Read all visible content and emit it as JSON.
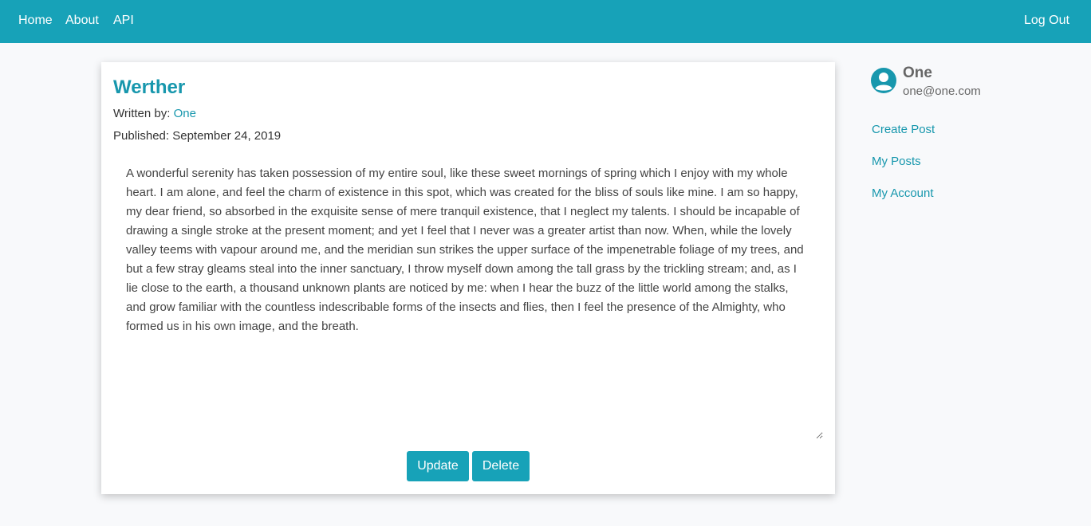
{
  "nav": {
    "home": "Home",
    "about": "About",
    "api": "API",
    "logout": "Log Out"
  },
  "post": {
    "title": "Werther",
    "written_by_label": "Written by:",
    "author": "One",
    "published": "Published: September 24, 2019",
    "content": "A wonderful serenity has taken possession of my entire soul, like these sweet mornings of spring which I enjoy with my whole heart. I am alone, and feel the charm of existence in this spot, which was created for the bliss of souls like mine. I am so happy, my dear friend, so absorbed in the exquisite sense of mere tranquil existence, that I neglect my talents. I should be incapable of drawing a single stroke at the present moment; and yet I feel that I never was a greater artist than now. When, while the lovely valley teems with vapour around me, and the meridian sun strikes the upper surface of the impenetrable foliage of my trees, and but a few stray gleams steal into the inner sanctuary, I throw myself down among the tall grass by the trickling stream; and, as I lie close to the earth, a thousand unknown plants are noticed by me: when I hear the buzz of the little world among the stalks, and grow familiar with the countless indescribable forms of the insects and flies, then I feel the presence of the Almighty, who formed us in his own image, and the breath.",
    "update_label": "Update",
    "delete_label": "Delete"
  },
  "sidebar": {
    "name": "One",
    "email": "one@one.com",
    "links": [
      "Create Post",
      "My Posts",
      "My Account"
    ]
  },
  "colors": {
    "accent": "#17a2b8",
    "link": "#1797ad"
  },
  "icons": {
    "profile": "user-circle-icon",
    "resize": "resize-grip-icon"
  }
}
